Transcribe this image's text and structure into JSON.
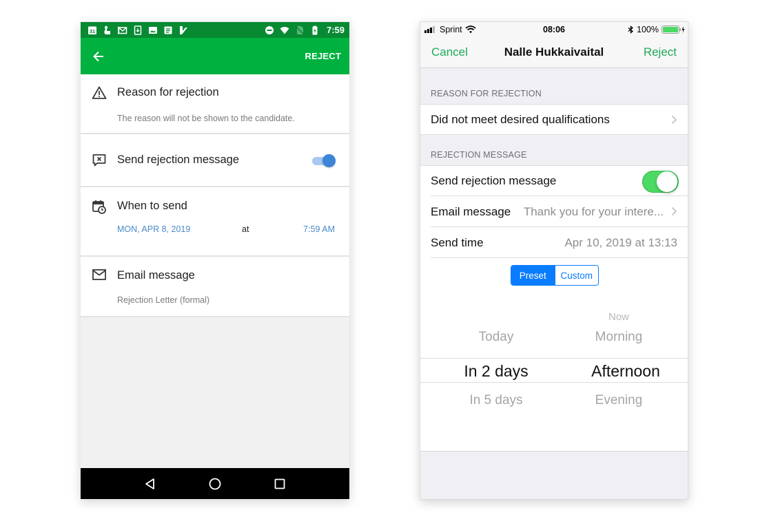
{
  "android": {
    "status_bar": {
      "left_icons": [
        "calendar-31-icon",
        "hand-pointer-icon",
        "gmail-icon",
        "download-icon",
        "image-icon",
        "notes-icon",
        "check-app-icon"
      ],
      "calendar_day": "31",
      "right_icons": [
        "do-not-disturb-icon",
        "wifi-icon",
        "no-sim-icon",
        "battery-charging-icon"
      ],
      "time": "7:59"
    },
    "toolbar": {
      "back_icon": "arrow-left-icon",
      "action_label": "REJECT",
      "color": "#00b140"
    },
    "reason": {
      "title": "Reason for rejection",
      "subtitle": "The reason will not be shown to the candidate.",
      "icon": "warning-icon"
    },
    "send_message": {
      "title": "Send rejection message",
      "icon": "message-x-icon",
      "enabled": true
    },
    "when": {
      "title": "When to send",
      "icon": "calendar-clock-icon",
      "date": "MON, APR 8, 2019",
      "at": "at",
      "time": "7:59 AM"
    },
    "email": {
      "title": "Email message",
      "icon": "envelope-icon",
      "value": "Rejection Letter (formal)"
    },
    "navbar": [
      "back-triangle-icon",
      "home-circle-icon",
      "recents-square-icon"
    ]
  },
  "ios": {
    "status_bar": {
      "carrier": "Sprint",
      "time": "08:06",
      "battery": "100%"
    },
    "nav": {
      "cancel": "Cancel",
      "title": "Nalle Hukkaivaital",
      "reject": "Reject",
      "accent": "#1faa59"
    },
    "reason_header": "REASON FOR REJECTION",
    "reason_value": "Did not meet desired qualifications",
    "message_header": "REJECTION MESSAGE",
    "send_message": {
      "label": "Send rejection message",
      "enabled": true
    },
    "email_message": {
      "label": "Email message",
      "value": "Thank you for your intere..."
    },
    "send_time": {
      "label": "Send time",
      "value": "Apr 10, 2019 at 13:13"
    },
    "segment": {
      "options": [
        "Preset",
        "Custom"
      ],
      "selected": "Preset"
    },
    "picker": {
      "days": {
        "above": "Today",
        "selected": "In 2 days",
        "below": "In 5 days"
      },
      "times": {
        "above2": "Now",
        "above": "Morning",
        "selected": "Afternoon",
        "below": "Evening"
      }
    }
  }
}
